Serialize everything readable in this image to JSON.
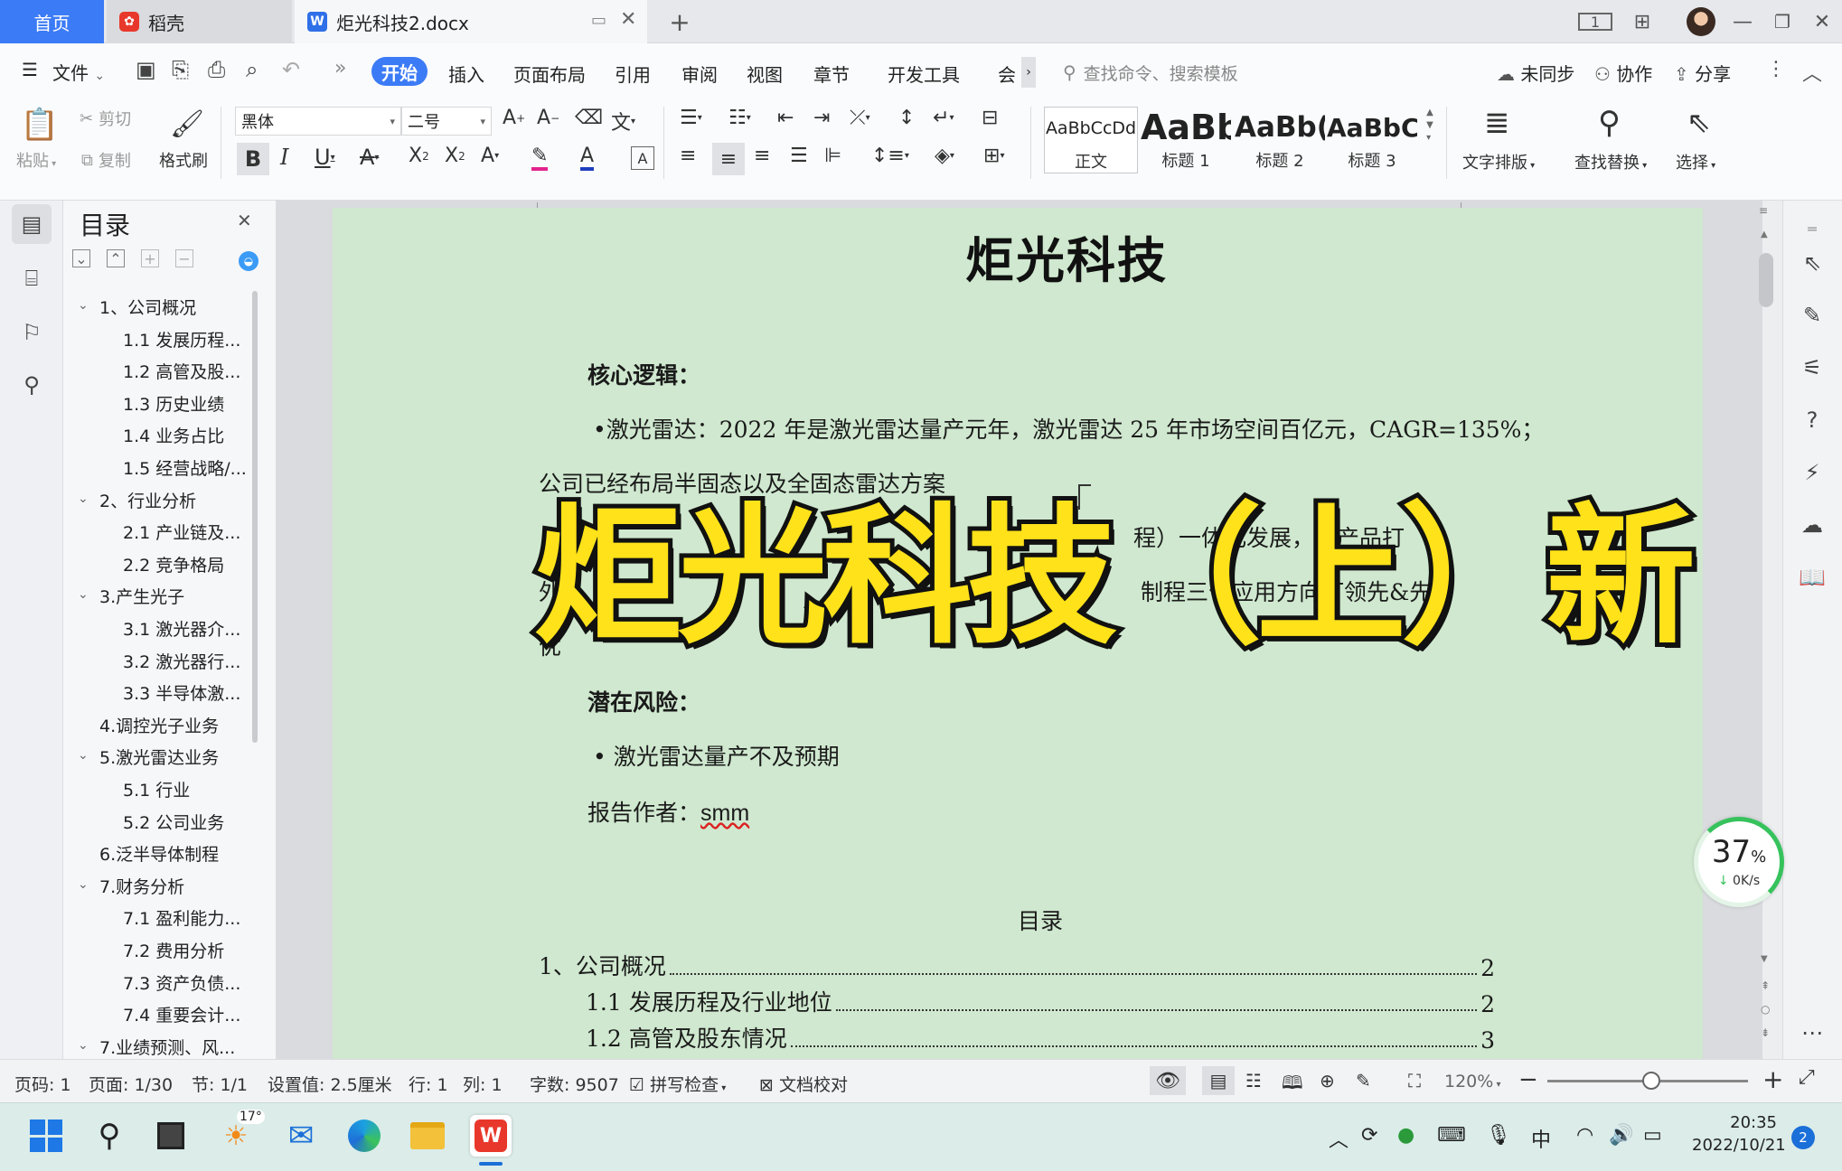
{
  "tabs": {
    "home": "首页",
    "daoke": "稻壳",
    "doc": "炬光科技2.docx"
  },
  "menu": {
    "file": "文件",
    "items": [
      "开始",
      "插入",
      "页面布局",
      "引用",
      "审阅",
      "视图",
      "章节",
      "开发工具",
      "会"
    ],
    "search_placeholder": "查找命令、搜索模板",
    "sync": "未同步",
    "collab": "协作",
    "share": "分享"
  },
  "ribbon": {
    "paste": "粘贴",
    "cut": "剪切",
    "copy": "复制",
    "format_painter": "格式刷",
    "font": "黑体",
    "size": "二号",
    "styles": [
      {
        "preview": "AaBbCcDd",
        "label": "正文"
      },
      {
        "preview": "AaBb",
        "label": "标题 1"
      },
      {
        "preview": "AaBb(",
        "label": "标题 2"
      },
      {
        "preview": "AaBbC",
        "label": "标题 3"
      }
    ],
    "text_layout": "文字排版",
    "find_replace": "查找替换",
    "select": "选择"
  },
  "toc_panel": {
    "title": "目录",
    "items": [
      {
        "label": "1、公司概况",
        "level": 1,
        "expanded": true
      },
      {
        "label": "1.1 发展历程...",
        "level": 2
      },
      {
        "label": "1.2 高管及股...",
        "level": 2
      },
      {
        "label": "1.3 历史业绩",
        "level": 2
      },
      {
        "label": "1.4 业务占比",
        "level": 2
      },
      {
        "label": "1.5 经营战略/...",
        "level": 2
      },
      {
        "label": "2、行业分析",
        "level": 1,
        "expanded": true
      },
      {
        "label": "2.1 产业链及...",
        "level": 2
      },
      {
        "label": "2.2 竞争格局",
        "level": 2
      },
      {
        "label": "3.产生光子",
        "level": 1,
        "expanded": true
      },
      {
        "label": "3.1 激光器介...",
        "level": 2
      },
      {
        "label": "3.2 激光器行...",
        "level": 2
      },
      {
        "label": "3.3 半导体激...",
        "level": 2
      },
      {
        "label": "4.调控光子业务",
        "level": 1
      },
      {
        "label": "5.激光雷达业务",
        "level": 1,
        "expanded": true
      },
      {
        "label": "5.1 行业",
        "level": 2
      },
      {
        "label": "5.2 公司业务",
        "level": 2
      },
      {
        "label": "6.泛半导体制程",
        "level": 1
      },
      {
        "label": "7.财务分析",
        "level": 1,
        "expanded": true
      },
      {
        "label": "7.1 盈利能力...",
        "level": 2
      },
      {
        "label": "7.2 费用分析",
        "level": 2
      },
      {
        "label": "7.3 资产负债...",
        "level": 2
      },
      {
        "label": "7.4 重要会计...",
        "level": 2
      },
      {
        "label": "7.业绩预测、风...",
        "level": 1,
        "expanded": true
      }
    ]
  },
  "document": {
    "title": "炬光科技",
    "core_heading": "核心逻辑：",
    "bullet1_a": "•激光雷达：2022 年是激光雷达量产元年，激光雷达 25 年市场空间百亿元，CAGR=135%；",
    "bullet1_b": "公司已经布局半固态以及全固态雷达方案",
    "partial1": "程）一体化发展，多产品打",
    "partial2": "外",
    "partial3": "制程三个应用方向打领先&先",
    "partial4": "优",
    "risk_heading": "潜在风险：",
    "risk1": "• 激光雷达量产不及预期",
    "author_label": "报告作者：",
    "author": "smm",
    "toc_heading": "目录",
    "toc_lines": [
      {
        "text": "1、公司概况",
        "page": "2"
      },
      {
        "text": "1.1 发展历程及行业地位",
        "page": "2"
      },
      {
        "text": "1.2 高管及股东情况",
        "page": "3"
      }
    ],
    "overlay": "炬光科技（上）新"
  },
  "speed_widget": {
    "percent": "37",
    "percent_sign": "%",
    "rate": "0K/s"
  },
  "status": {
    "page_code": "页码: 1",
    "page": "页面: 1/30",
    "section": "节: 1/1",
    "setting": "设置值: 2.5厘米",
    "row": "行: 1",
    "col": "列: 1",
    "words": "字数: 9507",
    "spell": "拼写检查",
    "proof": "文档校对",
    "zoom": "120%"
  },
  "taskbar": {
    "weather": "17°",
    "ime": "中",
    "time": "20:35",
    "date": "2022/10/21",
    "notif": "2"
  }
}
